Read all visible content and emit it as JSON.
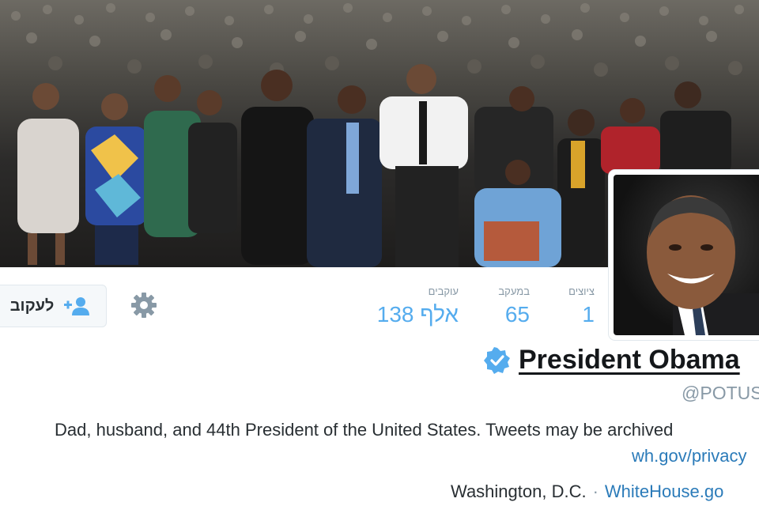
{
  "header": {
    "photo": "crowd-march-photo"
  },
  "actions": {
    "follow_label": "לעקוב",
    "follow_icon": "add-user-icon",
    "settings_icon": "gear-icon"
  },
  "stats": {
    "tweets": {
      "label": "ציוצים",
      "value": "1"
    },
    "following": {
      "label": "במעקב",
      "value": "65"
    },
    "followers": {
      "label": "עוקבים",
      "value": "138 אלף"
    }
  },
  "profile": {
    "name": "President Obama",
    "verified_icon": "verified-badge-icon",
    "screen_name": "@POTUS",
    "bio": "Dad, husband, and 44th President of the United States. Tweets may be archived",
    "bio_link": "wh.gov/privacy",
    "location": "Washington, D.C.",
    "separator": "·",
    "url": "WhiteHouse.go"
  },
  "colors": {
    "link": "#2b7bb9",
    "stat_value": "#55acee",
    "verified": "#55acee",
    "muted": "#8899a6"
  }
}
